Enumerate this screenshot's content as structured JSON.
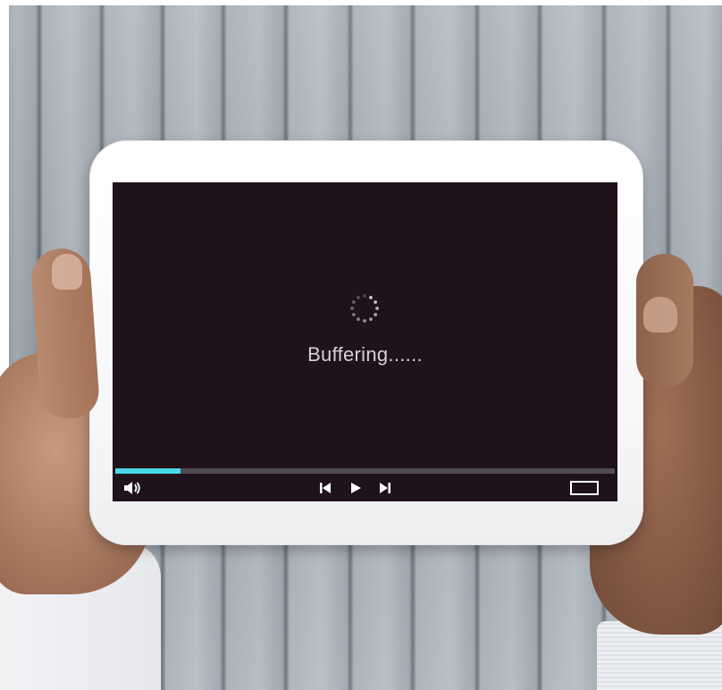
{
  "player": {
    "status_text": "Buffering......",
    "progress": 0.13,
    "colors": {
      "screen_bg": "#20121a",
      "progress_fill": "#4ad7e7",
      "progress_track": "#514a52",
      "status_text": "#d6d1d4",
      "controls": "#ffffff"
    },
    "icons": {
      "spinner": "loading-spinner-icon",
      "volume": "volume-icon",
      "previous": "skip-previous-icon",
      "play": "play-icon",
      "next": "skip-next-icon",
      "fullscreen": "fullscreen-icon"
    }
  }
}
